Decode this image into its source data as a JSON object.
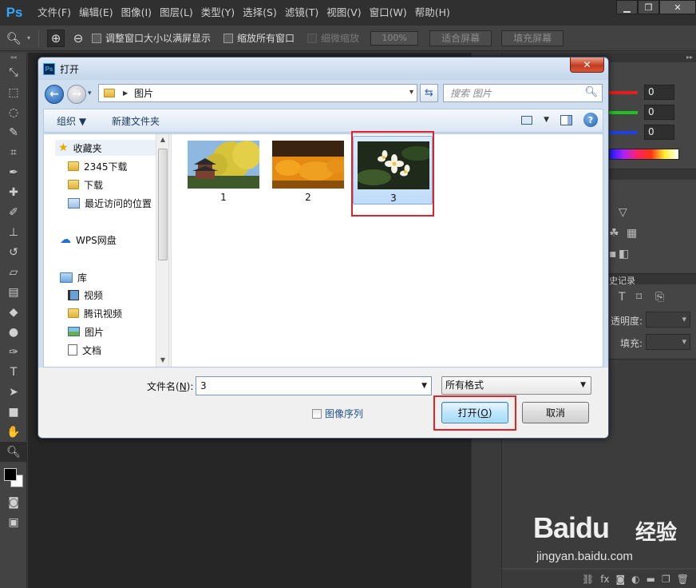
{
  "app": {
    "logo": "Ps",
    "menu": [
      "文件(F)",
      "编辑(E)",
      "图像(I)",
      "图层(L)",
      "类型(Y)",
      "选择(S)",
      "滤镜(T)",
      "视图(V)",
      "窗口(W)",
      "帮助(H)"
    ],
    "window_controls": {
      "minimize": "▁",
      "restore": "❐",
      "close": "✕"
    }
  },
  "options_bar": {
    "resize_windows_label": "调整窗口大小以满屏显示",
    "zoom_all_label": "缩放所有窗口",
    "scrubby_zoom_label": "细微缩放",
    "zoom_value": "100%",
    "fit_screen_label": "适合屏幕",
    "fill_screen_label": "填充屏幕"
  },
  "right_panel": {
    "color_values": [
      "0",
      "0",
      "0"
    ],
    "history_tab": "史记录",
    "opacity_label": "透明度:",
    "fill_label": "填充:"
  },
  "dialog": {
    "title": "打开",
    "close_label": "✕",
    "address": "图片",
    "search_placeholder": "搜索 图片",
    "organize_label": "组织 ▼",
    "new_folder_label": "新建文件夹",
    "nav": {
      "favorites": "收藏夹",
      "downloads_2345": "2345下载",
      "downloads": "下载",
      "recent": "最近访问的位置",
      "wps_drive": "WPS网盘",
      "libraries": "库",
      "videos": "视频",
      "tencent_video": "腾讯视频",
      "pictures": "图片",
      "documents": "文档"
    },
    "files": [
      {
        "name": "1",
        "icon": "pavilion-yellow-tree-photo"
      },
      {
        "name": "2",
        "icon": "orange-flower-field-photo"
      },
      {
        "name": "3",
        "icon": "white-plumeria-flower-photo"
      }
    ],
    "filename_label": "文件名(N):",
    "filename_value": "3",
    "filetype_value": "所有格式",
    "image_sequence_label": "图像序列",
    "open_button": "打开(O)",
    "cancel_button": "取消"
  },
  "watermark": {
    "logo": "Baidu",
    "cn": "经验",
    "sub": "jingyan.baidu.com"
  },
  "colors": {
    "highlight_red": "#e0222a",
    "ps_blue": "#31a8ff",
    "selection_blue": "#c1dcfa"
  }
}
